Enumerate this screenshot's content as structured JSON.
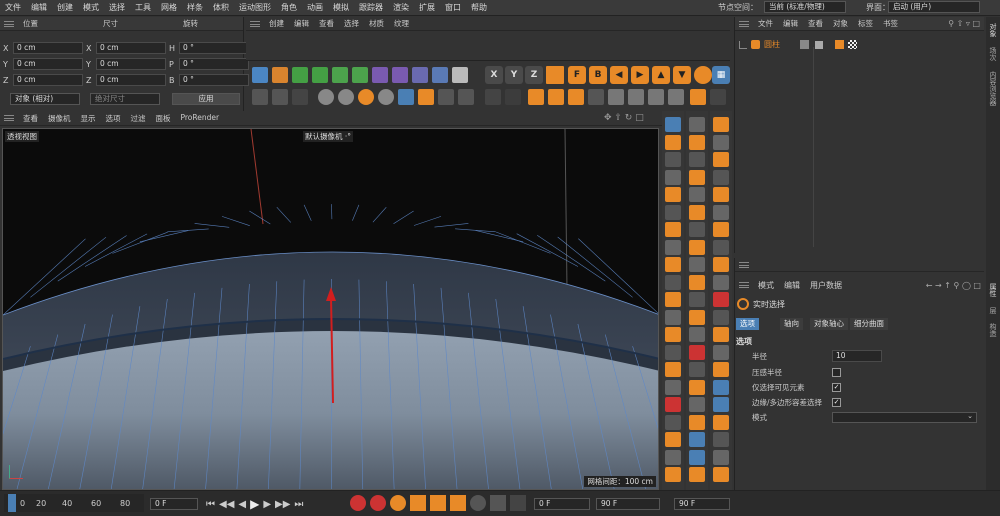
{
  "menubar": {
    "items": [
      "文件",
      "编辑",
      "创建",
      "模式",
      "选择",
      "工具",
      "网格",
      "样条",
      "体积",
      "运动图形",
      "角色",
      "动画",
      "模拟",
      "跟踪器",
      "渲染",
      "扩展",
      "窗口",
      "帮助"
    ],
    "node_space_label": "节点空间：",
    "node_space_value": "当前 (标准/物理)",
    "layout_label": "界面：",
    "layout_value": "启动 (用户)"
  },
  "coords": {
    "headers": [
      "位置",
      "尺寸",
      "旋转"
    ],
    "rows": [
      {
        "a": "X",
        "av": "0 cm",
        "b": "X",
        "bv": "0 cm",
        "c": "H",
        "cv": "0 °"
      },
      {
        "a": "Y",
        "av": "0 cm",
        "b": "Y",
        "bv": "0 cm",
        "c": "P",
        "cv": "0 °"
      },
      {
        "a": "Z",
        "av": "0 cm",
        "b": "Z",
        "bv": "0 cm",
        "c": "B",
        "cv": "0 °"
      }
    ],
    "mode_select": "对象 (相对)",
    "size_select": "绝对尺寸",
    "apply_button": "应用"
  },
  "toolbar_menu": [
    "创建",
    "编辑",
    "查看",
    "选择",
    "材质",
    "纹理"
  ],
  "axis_buttons": [
    "X",
    "Y",
    "Z"
  ],
  "snap_buttons": [
    "F",
    "B"
  ],
  "viewport": {
    "menu": [
      "查看",
      "摄像机",
      "显示",
      "选项",
      "过滤",
      "面板",
      "ProRender"
    ],
    "name": "透视视图",
    "camera": "默认摄像机 ·°",
    "grid_info": "网格间距：100 cm"
  },
  "objects": {
    "menu": [
      "文件",
      "编辑",
      "查看",
      "对象",
      "标签",
      "书签"
    ],
    "item": "圆柱"
  },
  "attributes": {
    "menu": [
      "模式",
      "编辑",
      "用户数据"
    ],
    "tool_name": "实时选择",
    "tabs": [
      "选项",
      "轴向",
      "对象轴心",
      "细分曲面"
    ],
    "section": "选项",
    "radius_label": "半径",
    "radius_value": "10",
    "pressure_label": "压感半径",
    "visible_label": "仅选择可见元素",
    "edge_label": "边缘/多边形容差选择",
    "mode_label": "模式"
  },
  "right_tabs": [
    "对象",
    "场次",
    "内容浏览器"
  ],
  "right_tabs2": [
    "属性",
    "层",
    "构造"
  ],
  "timeline": {
    "ticks": [
      "0",
      "20",
      "40",
      "60",
      "80"
    ],
    "current_frame": "0 F",
    "start_frame": "0 F",
    "end_frame": "90 F",
    "end_frame2": "90 F"
  },
  "colors": {
    "accent": "#e88a28",
    "selection": "#4a7fb4",
    "panel": "#333333"
  }
}
